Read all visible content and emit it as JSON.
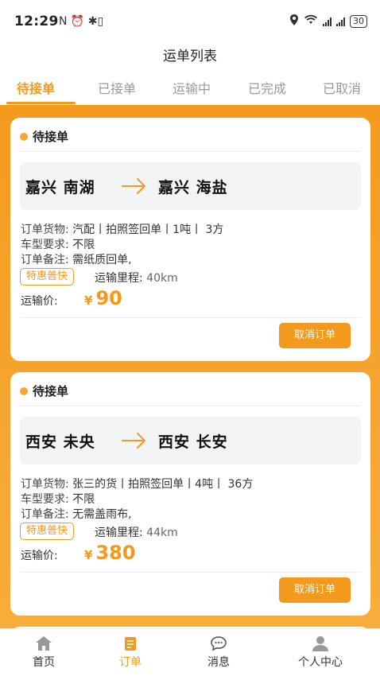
{
  "status_bar": {
    "time": "12:29",
    "left_icons": "N ⏰ ✱▯",
    "battery": "30"
  },
  "header": {
    "title": "运单列表"
  },
  "tabs": [
    {
      "label": "待接单",
      "active": true
    },
    {
      "label": "已接单",
      "active": false
    },
    {
      "label": "运输中",
      "active": false
    },
    {
      "label": "已完成",
      "active": false
    },
    {
      "label": "已取消",
      "active": false
    }
  ],
  "orders": [
    {
      "status": "待接单",
      "from": "嘉兴 南湖",
      "to": "嘉兴 海盐",
      "cargo_label": "订单货物:",
      "cargo": "汽配丨拍照签回单丨1吨丨 3方",
      "vehicle_label": "车型要求:",
      "vehicle": "不限",
      "remark_label": "订单备注:",
      "remark": "需纸质回单,",
      "tag": "特惠普快",
      "distance_label": "运输里程:",
      "distance": "40km",
      "price_label": "运输价:",
      "currency": "¥",
      "price": "90",
      "cancel_label": "取消订单"
    },
    {
      "status": "待接单",
      "from": "西安 未央",
      "to": "西安 长安",
      "cargo_label": "订单货物:",
      "cargo": "张三的货丨拍照签回单丨4吨丨 36方",
      "vehicle_label": "车型要求:",
      "vehicle": "不限",
      "remark_label": "订单备注:",
      "remark": "无需盖雨布,",
      "tag": "特惠普快",
      "distance_label": "运输里程:",
      "distance": "44km",
      "price_label": "运输价:",
      "currency": "¥",
      "price": "380",
      "cancel_label": "取消订单"
    }
  ],
  "bottom_nav": [
    {
      "label": "首页",
      "icon": "home-icon",
      "active": false
    },
    {
      "label": "订单",
      "icon": "order-icon",
      "active": true
    },
    {
      "label": "消息",
      "icon": "message-icon",
      "active": false
    },
    {
      "label": "个人中心",
      "icon": "user-icon",
      "active": false
    }
  ],
  "colors": {
    "accent": "#f39a1e",
    "background_orange": "#f7a531"
  }
}
